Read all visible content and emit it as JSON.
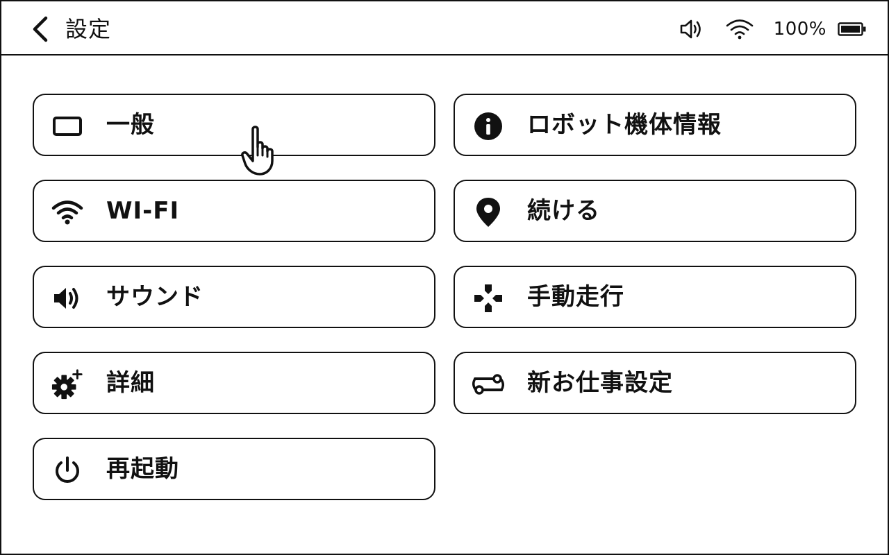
{
  "header": {
    "title": "設定",
    "back_icon": "chevron-left-icon",
    "status": {
      "volume_icon": "speaker-icon",
      "wifi_icon": "wifi-icon",
      "battery_percent": "100%",
      "battery_icon": "battery-full-icon"
    }
  },
  "menu": {
    "left": [
      {
        "label": "一般",
        "icon": "screen-icon"
      },
      {
        "label": "WI-FI",
        "icon": "wifi-icon"
      },
      {
        "label": "サウンド",
        "icon": "speaker-icon"
      },
      {
        "label": "詳細",
        "icon": "gear-plus-icon"
      },
      {
        "label": "再起動",
        "icon": "power-icon"
      }
    ],
    "right": [
      {
        "label": "ロボット機体情報",
        "icon": "info-icon"
      },
      {
        "label": "続ける",
        "icon": "location-pin-icon"
      },
      {
        "label": "手動走行",
        "icon": "dpad-icon"
      },
      {
        "label": "新お仕事設定",
        "icon": "route-icon"
      }
    ]
  },
  "cursor": {
    "icon": "hand-pointer-icon"
  }
}
